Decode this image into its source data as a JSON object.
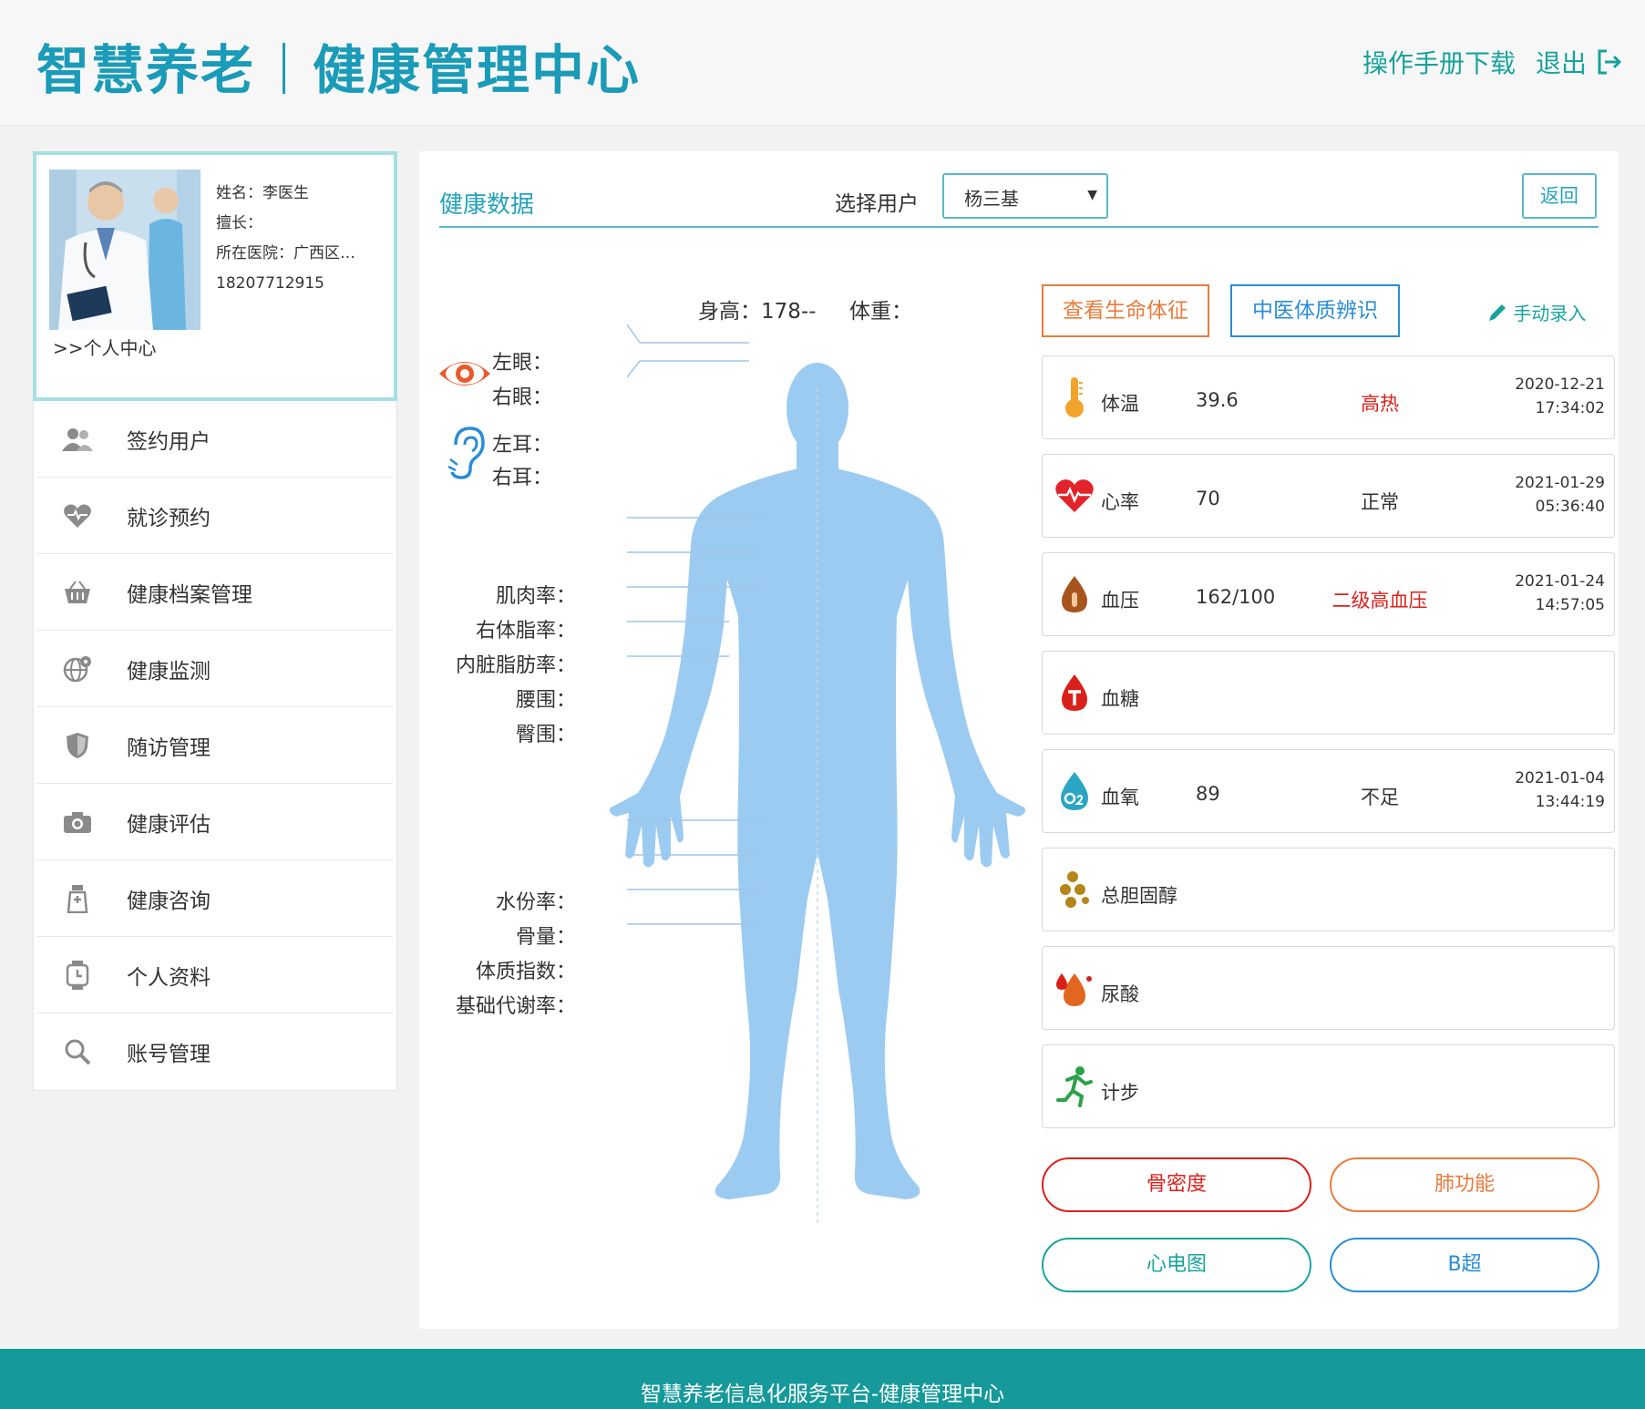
{
  "header": {
    "logo_part1": "智慧养老",
    "logo_part2": "健康管理中心",
    "manual_download": "操作手册下载",
    "logout": "退出"
  },
  "profile": {
    "name": "姓名：李医生",
    "specialty": "擅长：",
    "hospital": "所在医院：广西区…",
    "phone": "18207712915",
    "center_link": ">>个人中心"
  },
  "menu": [
    {
      "label": "签约用户",
      "icon": "users-icon"
    },
    {
      "label": "就诊预约",
      "icon": "heart-icon"
    },
    {
      "label": "健康档案管理",
      "icon": "basket-icon"
    },
    {
      "label": "健康监测",
      "icon": "globe-icon"
    },
    {
      "label": "随访管理",
      "icon": "shield-icon"
    },
    {
      "label": "健康评估",
      "icon": "camera-icon"
    },
    {
      "label": "健康咨询",
      "icon": "bottle-icon"
    },
    {
      "label": "个人资料",
      "icon": "watch-icon"
    },
    {
      "label": "账号管理",
      "icon": "search-icon"
    }
  ],
  "main": {
    "title": "健康数据",
    "select_user_label": "选择用户",
    "selected_user": "杨三基",
    "back_button": "返回",
    "height_label": "身高：",
    "height_value": "178--",
    "weight_label": "体重：",
    "left_eye": "左眼：",
    "right_eye": "右眼：",
    "left_ear": "左耳：",
    "right_ear": "右耳：",
    "muscle_rate": "肌肉率：",
    "body_fat_rate": "右体脂率：",
    "visceral_fat_rate": "内脏脂肪率：",
    "waist": "腰围：",
    "hip": "臀围：",
    "water_rate": "水份率：",
    "bone_mass": "骨量：",
    "bmi": "体质指数：",
    "bmr": "基础代谢率：",
    "vital_signs_button": "查看生命体征",
    "tcm_button": "中医体质辨识",
    "manual_entry": "手动录入"
  },
  "cards": [
    {
      "name": "体温",
      "value": "39.6",
      "status": "高热",
      "status_color": "#d9211c",
      "date": "2020-12-21",
      "time": "17:34:02",
      "icon": "thermometer-icon"
    },
    {
      "name": "心率",
      "value": "70",
      "status": "正常",
      "status_color": "#333333",
      "date": "2021-01-29",
      "time": "05:36:40",
      "icon": "heartbeat-icon"
    },
    {
      "name": "血压",
      "value": "162/100",
      "status": "二级高血压",
      "status_color": "#d9211c",
      "date": "2021-01-24",
      "time": "14:57:05",
      "icon": "blood-pressure-icon"
    },
    {
      "name": "血糖",
      "value": "",
      "status": "",
      "status_color": "#333333",
      "date": "",
      "time": "",
      "icon": "blood-sugar-icon"
    },
    {
      "name": "血氧",
      "value": "89",
      "status": "不足",
      "status_color": "#333333",
      "date": "2021-01-04",
      "time": "13:44:19",
      "icon": "oxygen-icon"
    },
    {
      "name": "总胆固醇",
      "value": "",
      "status": "",
      "status_color": "#333333",
      "date": "",
      "time": "",
      "icon": "cholesterol-icon"
    },
    {
      "name": "尿酸",
      "value": "",
      "status": "",
      "status_color": "#333333",
      "date": "",
      "time": "",
      "icon": "uric-acid-icon"
    },
    {
      "name": "计步",
      "value": "",
      "status": "",
      "status_color": "#333333",
      "date": "",
      "time": "",
      "icon": "running-icon"
    }
  ],
  "pills": {
    "bone_density": "骨密度",
    "lung_function": "肺功能",
    "ecg": "心电图",
    "b_ultrasound": "B超"
  },
  "footer": {
    "text": "智慧养老信息化服务平台-健康管理中心"
  },
  "colors": {
    "brand": "#1a9bb8",
    "teal": "#19a39c",
    "footer_bg": "#16999a",
    "body_silhouette": "#9ccbf1",
    "alert_red": "#d9211c",
    "orange": "#e87b3c"
  }
}
